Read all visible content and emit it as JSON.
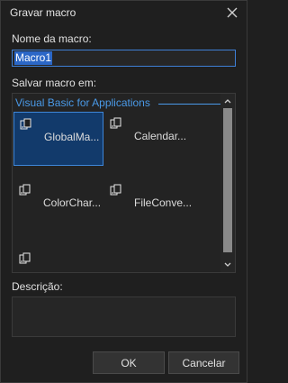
{
  "window": {
    "title": "Gravar macro"
  },
  "name_section": {
    "label": "Nome da macro:",
    "value": "Macro1"
  },
  "save_section": {
    "label": "Salvar macro em:"
  },
  "tree": {
    "group": "Visual Basic for Applications",
    "items": [
      {
        "label": "GlobalMa...",
        "icon": "module-icon",
        "selected": true
      },
      {
        "label": "Calendar...",
        "icon": "module-icon",
        "selected": false
      },
      {
        "label": "ColorChar...",
        "icon": "module-icon",
        "selected": false
      },
      {
        "label": "FileConve...",
        "icon": "module-icon",
        "selected": false
      },
      {
        "label": "",
        "icon": "module-icon",
        "selected": false
      }
    ]
  },
  "description": {
    "label": "Descrição:",
    "value": ""
  },
  "buttons": {
    "ok": "OK",
    "cancel": "Cancelar"
  },
  "colors": {
    "accent": "#3e86d8",
    "selection": "#123a6b",
    "background": "#1f1f1f"
  }
}
